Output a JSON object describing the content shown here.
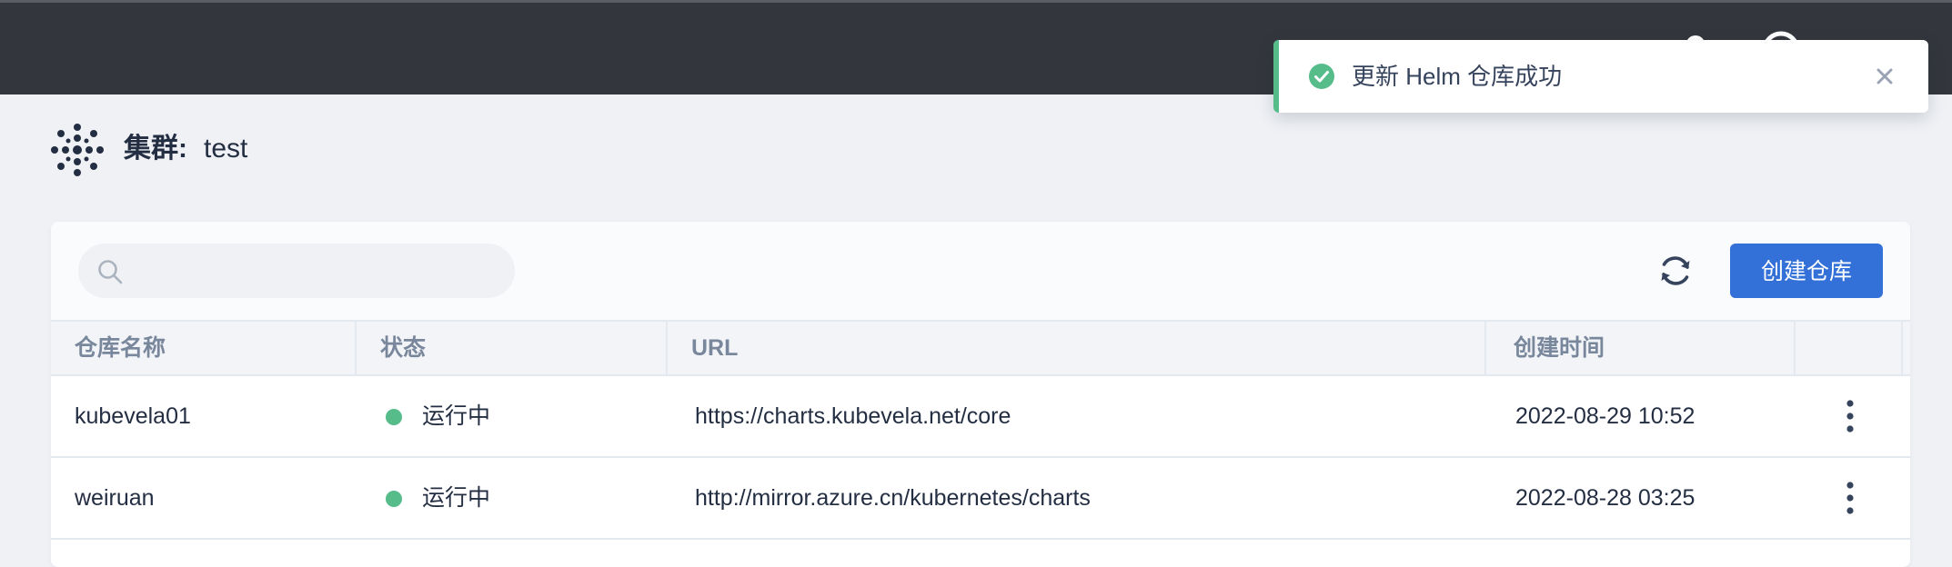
{
  "toast": {
    "message": "更新 Helm 仓库成功",
    "icon": "check-circle-icon",
    "close_icon": "close-icon",
    "accent": "#55bc8a"
  },
  "cluster": {
    "label": "集群:",
    "name": "test",
    "icon": "cluster-icon"
  },
  "toolbar": {
    "search_placeholder": "",
    "refresh_icon": "refresh-icon",
    "create_label": "创建仓库",
    "create_color": "#3370d7"
  },
  "table": {
    "headers": [
      "仓库名称",
      "状态",
      "URL",
      "创建时间"
    ],
    "rows": [
      {
        "name": "kubevela01",
        "status": "运行中",
        "url": "https://charts.kubevela.net/core",
        "created": "2022-08-29 10:52"
      },
      {
        "name": "weiruan",
        "status": "运行中",
        "url": "http://mirror.azure.cn/kubernetes/charts",
        "created": "2022-08-28 03:25"
      }
    ],
    "status_color": "#55bc8a"
  }
}
